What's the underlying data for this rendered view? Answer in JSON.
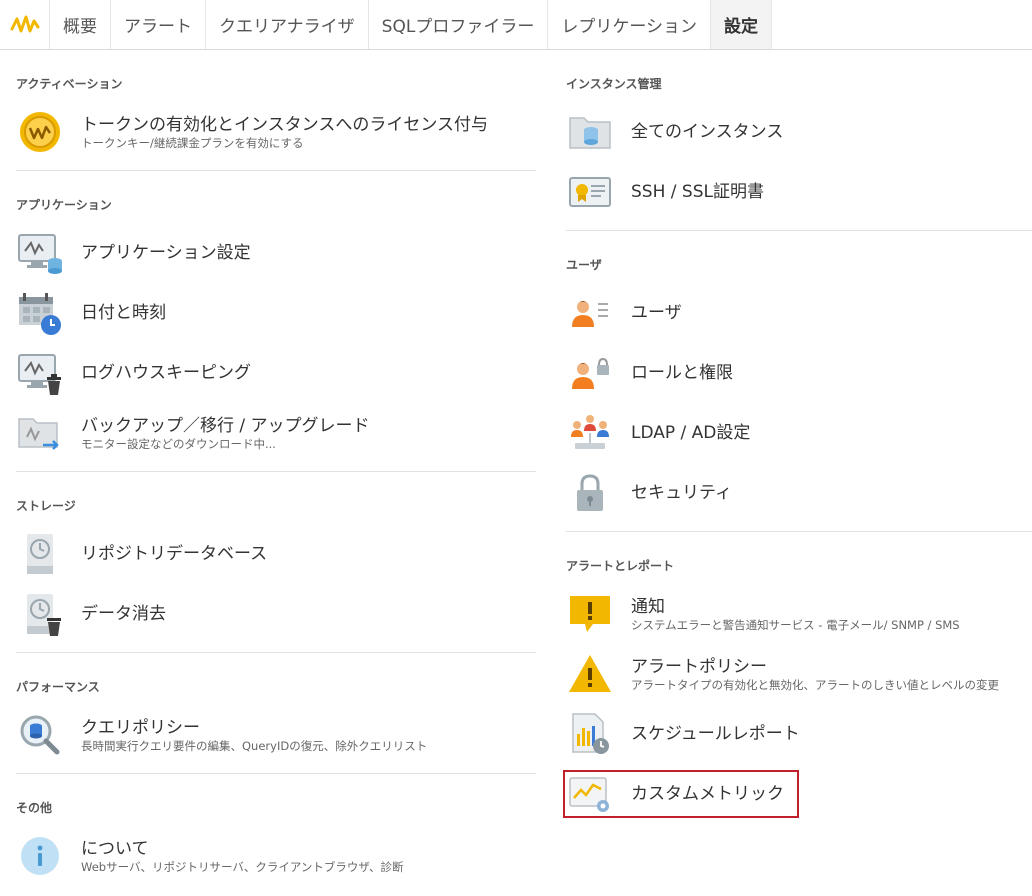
{
  "nav": {
    "tabs": [
      {
        "label": "概要"
      },
      {
        "label": "アラート"
      },
      {
        "label": "クエリアナライザ"
      },
      {
        "label": "SQLプロファイラー"
      },
      {
        "label": "レプリケーション"
      },
      {
        "label": "設定"
      }
    ],
    "active_tab": "設定"
  },
  "left": {
    "activation": {
      "title": "アクティベーション",
      "items": [
        {
          "label": "トークンの有効化とインスタンスへのライセンス付与",
          "sub": "トークンキー/継続課金プランを有効にする",
          "icon": "token-coin-icon"
        }
      ]
    },
    "application": {
      "title": "アプリケーション",
      "items": [
        {
          "label": "アプリケーション設定",
          "icon": "monitor-database-icon"
        },
        {
          "label": "日付と時刻",
          "icon": "calendar-clock-icon"
        },
        {
          "label": "ログハウスキーピング",
          "icon": "monitor-trash-icon"
        },
        {
          "label": "バックアップ／移行 / アップグレード",
          "sub": "モニター設定などのダウンロード中...",
          "icon": "folder-arrow-icon"
        }
      ]
    },
    "storage": {
      "title": "ストレージ",
      "items": [
        {
          "label": "リポジトリデータベース",
          "icon": "repository-history-icon"
        },
        {
          "label": "データ消去",
          "icon": "repository-trash-icon"
        }
      ]
    },
    "performance": {
      "title": "パフォーマンス",
      "items": [
        {
          "label": "クエリポリシー",
          "sub": "長時間実行クエリ要件の編集、QueryIDの復元、除外クエリリスト",
          "icon": "magnifier-database-icon"
        }
      ]
    },
    "other": {
      "title": "その他",
      "items": [
        {
          "label": "について",
          "sub": "Webサーバ、リポジトリサーバ、クライアントブラウザ、診断",
          "icon": "info-icon"
        }
      ]
    }
  },
  "right": {
    "instance": {
      "title": "インスタンス管理",
      "items": [
        {
          "label": "全てのインスタンス",
          "icon": "folder-database-icon"
        },
        {
          "label": "SSH / SSL証明書",
          "icon": "certificate-icon"
        }
      ]
    },
    "users": {
      "title": "ユーザ",
      "items": [
        {
          "label": "ユーザ",
          "icon": "user-list-icon"
        },
        {
          "label": "ロールと権限",
          "icon": "user-lock-icon"
        },
        {
          "label": "LDAP / AD設定",
          "icon": "user-group-icon"
        },
        {
          "label": "セキュリティ",
          "icon": "padlock-icon"
        }
      ]
    },
    "alerts": {
      "title": "アラートとレポート",
      "items": [
        {
          "label": "通知",
          "sub": "システムエラーと警告通知サービス - 電子メール/ SNMP / SMS",
          "icon": "notification-bubble-icon"
        },
        {
          "label": "アラートポリシー",
          "sub": "アラートタイプの有効化と無効化、アラートのしきい値とレベルの変更",
          "icon": "warning-triangle-icon"
        },
        {
          "label": "スケジュールレポート",
          "icon": "report-clock-icon"
        },
        {
          "label": "カスタムメトリック",
          "icon": "custom-metric-icon"
        }
      ]
    }
  },
  "colors": {
    "accent": "#f2b700",
    "highlight_border": "#c0202a",
    "divider": "#e2e2e2"
  }
}
